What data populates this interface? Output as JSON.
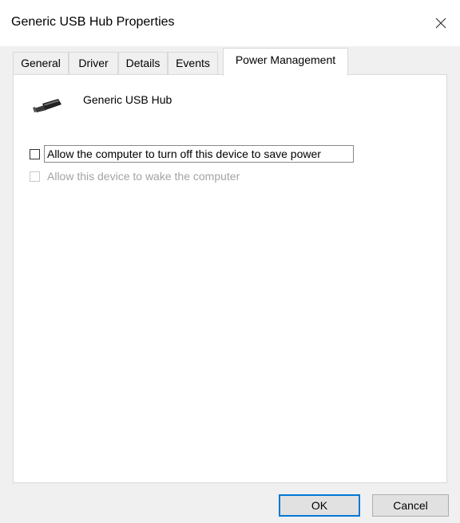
{
  "window": {
    "title": "Generic USB Hub Properties",
    "close_icon": "close-icon"
  },
  "tabs": [
    {
      "label": "General",
      "active": false
    },
    {
      "label": "Driver",
      "active": false
    },
    {
      "label": "Details",
      "active": false
    },
    {
      "label": "Events",
      "active": false
    },
    {
      "label": "Power Management",
      "active": true
    }
  ],
  "panel": {
    "device_icon": "usb-plug-icon",
    "device_name": "Generic USB Hub",
    "options": [
      {
        "label": "Allow the computer to turn off this device to save power",
        "checked": false,
        "enabled": true,
        "focused": true
      },
      {
        "label": "Allow this device to wake the computer",
        "checked": false,
        "enabled": false,
        "focused": false
      }
    ]
  },
  "buttons": {
    "ok_label": "OK",
    "cancel_label": "Cancel"
  },
  "colors": {
    "focus_accent": "#0078d7",
    "disabled_text": "#a3a3a3"
  }
}
